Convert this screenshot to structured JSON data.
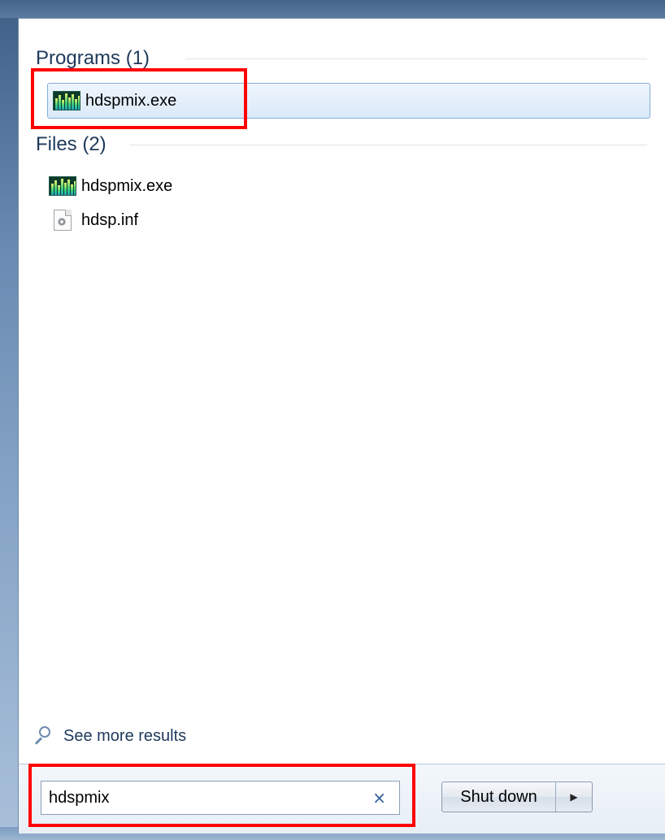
{
  "groups": {
    "programs": {
      "header": "Programs (1)",
      "items": [
        {
          "label": "hdspmix.exe",
          "icon": "mixer-app-icon"
        }
      ]
    },
    "files": {
      "header": "Files (2)",
      "items": [
        {
          "label": "hdspmix.exe",
          "icon": "mixer-app-icon"
        },
        {
          "label": "hdsp.inf",
          "icon": "settings-file-icon"
        }
      ]
    }
  },
  "see_more": "See more results",
  "search": {
    "value": "hdspmix",
    "clear_glyph": "×"
  },
  "shutdown": {
    "label": "Shut down",
    "arrow_glyph": "▶"
  },
  "highlight_color": "#ff0000",
  "selection_color": "#84acdd"
}
